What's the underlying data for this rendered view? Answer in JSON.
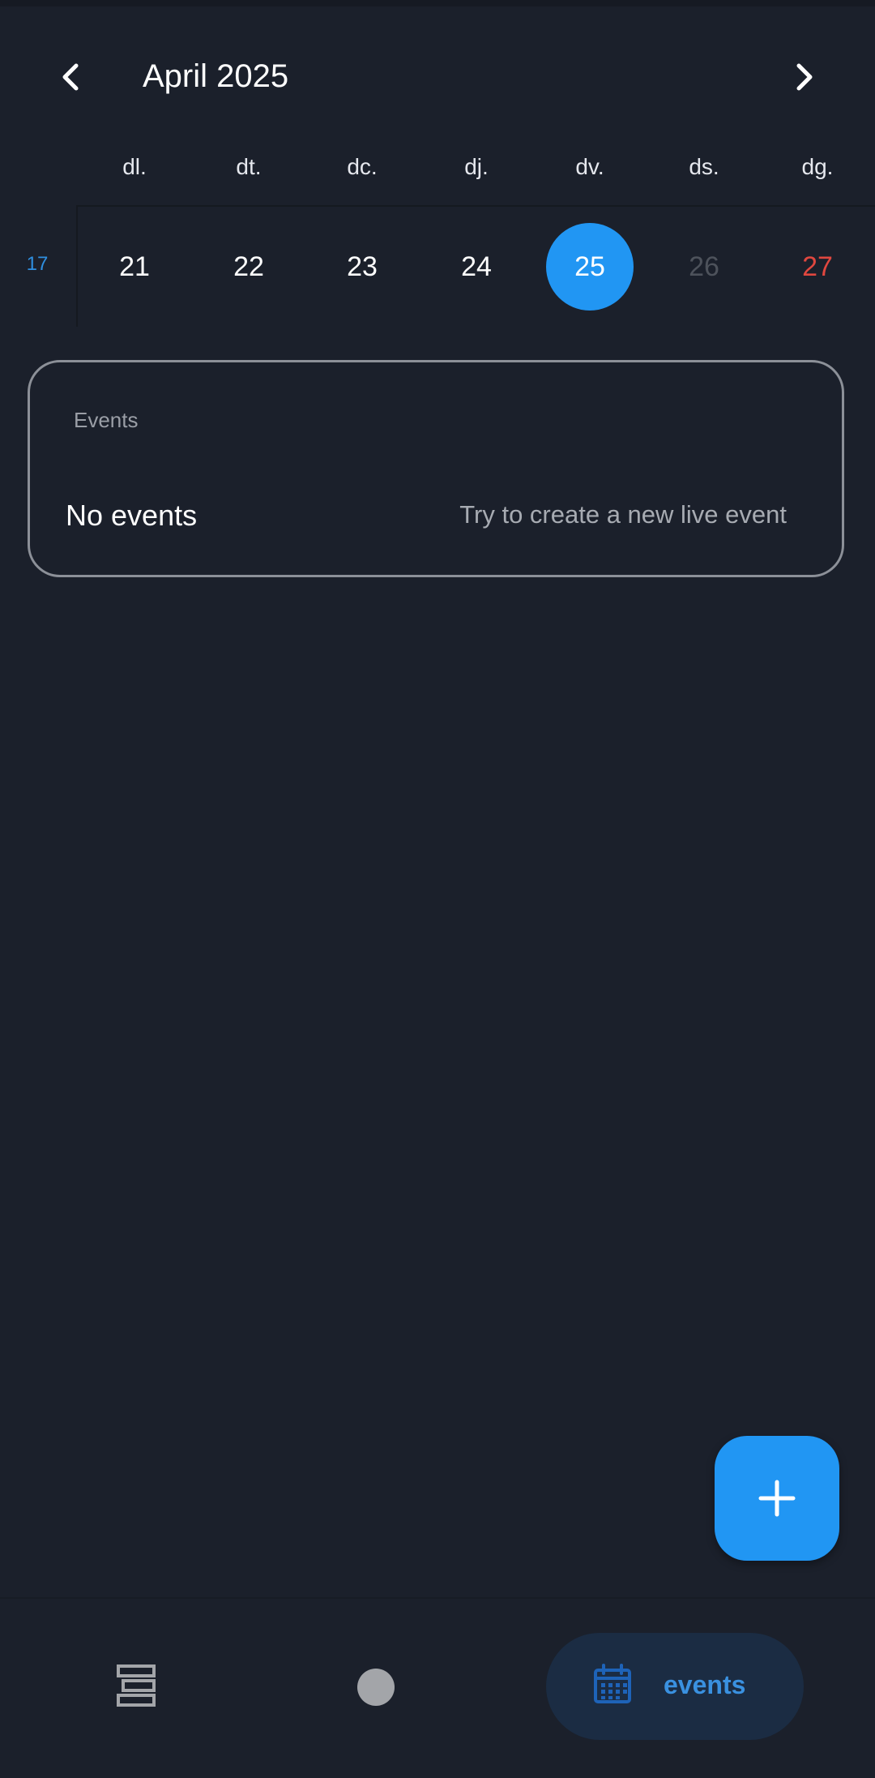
{
  "header": {
    "month_title": "April 2025"
  },
  "weekdays": [
    "dl.",
    "dt.",
    "dc.",
    "dj.",
    "dv.",
    "ds.",
    "dg."
  ],
  "week": {
    "number": "17",
    "days": [
      "21",
      "22",
      "23",
      "24",
      "25",
      "26",
      "27"
    ],
    "selected_day": "25"
  },
  "events_card": {
    "label": "Events",
    "empty_title": "No events",
    "empty_hint": "Try to create a new live event"
  },
  "bottom_nav": {
    "events_label": "events"
  },
  "colors": {
    "background": "#1b202b",
    "accent": "#2196f3",
    "sunday": "#e0473f",
    "muted": "#4d525b"
  }
}
